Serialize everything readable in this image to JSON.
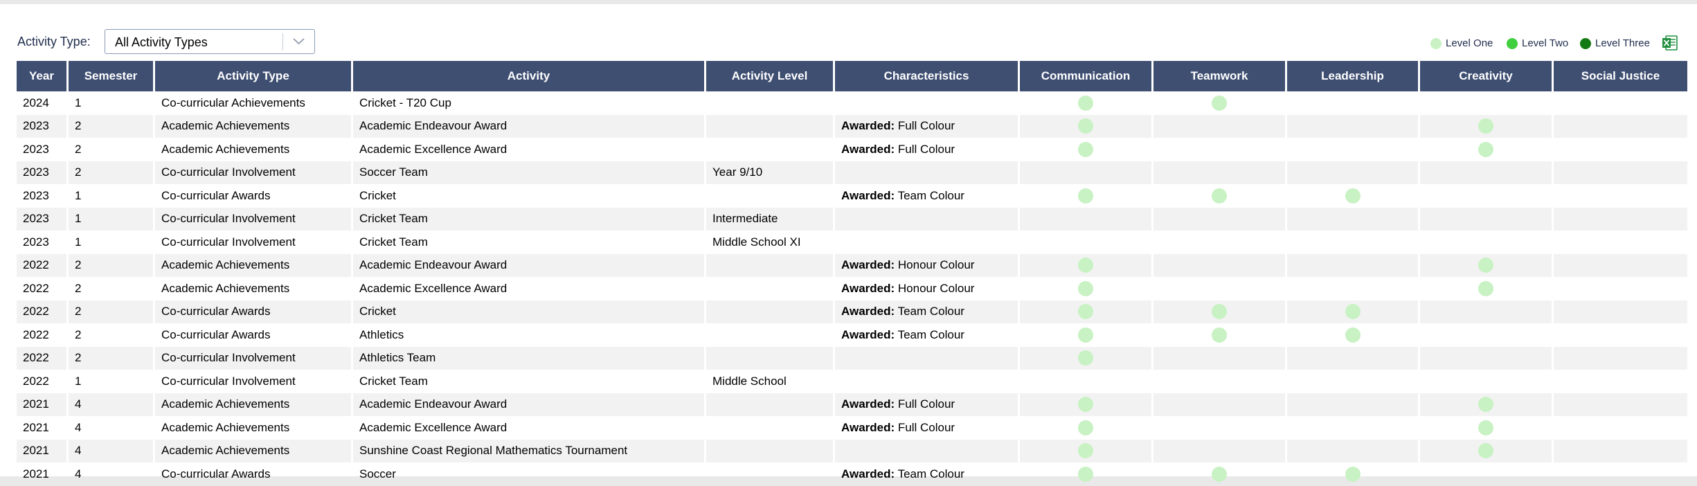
{
  "filter": {
    "label": "Activity Type:",
    "selected": "All Activity Types"
  },
  "legend": [
    {
      "label": "Level One",
      "color": "#c8f2c3"
    },
    {
      "label": "Level Two",
      "color": "#3fcf3f"
    },
    {
      "label": "Level Three",
      "color": "#137a13"
    }
  ],
  "export_icon": "excel-export-icon",
  "columns": [
    "Year",
    "Semester",
    "Activity Type",
    "Activity",
    "Activity Level",
    "Characteristics",
    "Communication",
    "Teamwork",
    "Leadership",
    "Creativity",
    "Social Justice"
  ],
  "awarded_label": "Awarded:",
  "rows": [
    {
      "year": "2024",
      "semester": "1",
      "type": "Co-curricular Achievements",
      "activity": "Cricket - T20 Cup",
      "level": "",
      "awarded": "",
      "skills": [
        1,
        1,
        0,
        0,
        0
      ]
    },
    {
      "year": "2023",
      "semester": "2",
      "type": "Academic Achievements",
      "activity": "Academic Endeavour Award",
      "level": "",
      "awarded": "Full Colour",
      "skills": [
        1,
        0,
        0,
        1,
        0
      ]
    },
    {
      "year": "2023",
      "semester": "2",
      "type": "Academic Achievements",
      "activity": "Academic Excellence Award",
      "level": "",
      "awarded": "Full Colour",
      "skills": [
        1,
        0,
        0,
        1,
        0
      ]
    },
    {
      "year": "2023",
      "semester": "2",
      "type": "Co-curricular Involvement",
      "activity": "Soccer Team",
      "level": "Year 9/10",
      "awarded": "",
      "skills": [
        0,
        0,
        0,
        0,
        0
      ]
    },
    {
      "year": "2023",
      "semester": "1",
      "type": "Co-curricular Awards",
      "activity": "Cricket",
      "level": "",
      "awarded": "Team Colour",
      "skills": [
        1,
        1,
        1,
        0,
        0
      ]
    },
    {
      "year": "2023",
      "semester": "1",
      "type": "Co-curricular Involvement",
      "activity": "Cricket Team",
      "level": "Intermediate",
      "awarded": "",
      "skills": [
        0,
        0,
        0,
        0,
        0
      ]
    },
    {
      "year": "2023",
      "semester": "1",
      "type": "Co-curricular Involvement",
      "activity": "Cricket Team",
      "level": "Middle School XI",
      "awarded": "",
      "skills": [
        0,
        0,
        0,
        0,
        0
      ]
    },
    {
      "year": "2022",
      "semester": "2",
      "type": "Academic Achievements",
      "activity": "Academic Endeavour Award",
      "level": "",
      "awarded": "Honour Colour",
      "skills": [
        1,
        0,
        0,
        1,
        0
      ]
    },
    {
      "year": "2022",
      "semester": "2",
      "type": "Academic Achievements",
      "activity": "Academic Excellence Award",
      "level": "",
      "awarded": "Honour Colour",
      "skills": [
        1,
        0,
        0,
        1,
        0
      ]
    },
    {
      "year": "2022",
      "semester": "2",
      "type": "Co-curricular Awards",
      "activity": "Cricket",
      "level": "",
      "awarded": "Team Colour",
      "skills": [
        1,
        1,
        1,
        0,
        0
      ]
    },
    {
      "year": "2022",
      "semester": "2",
      "type": "Co-curricular Awards",
      "activity": "Athletics",
      "level": "",
      "awarded": "Team Colour",
      "skills": [
        1,
        1,
        1,
        0,
        0
      ]
    },
    {
      "year": "2022",
      "semester": "2",
      "type": "Co-curricular Involvement",
      "activity": "Athletics Team",
      "level": "",
      "awarded": "",
      "skills": [
        1,
        0,
        0,
        0,
        0
      ]
    },
    {
      "year": "2022",
      "semester": "1",
      "type": "Co-curricular Involvement",
      "activity": "Cricket Team",
      "level": "Middle School",
      "awarded": "",
      "skills": [
        0,
        0,
        0,
        0,
        0
      ]
    },
    {
      "year": "2021",
      "semester": "4",
      "type": "Academic Achievements",
      "activity": "Academic Endeavour Award",
      "level": "",
      "awarded": "Full Colour",
      "skills": [
        1,
        0,
        0,
        1,
        0
      ]
    },
    {
      "year": "2021",
      "semester": "4",
      "type": "Academic Achievements",
      "activity": "Academic Excellence Award",
      "level": "",
      "awarded": "Full Colour",
      "skills": [
        1,
        0,
        0,
        1,
        0
      ]
    },
    {
      "year": "2021",
      "semester": "4",
      "type": "Academic Achievements",
      "activity": "Sunshine Coast Regional Mathematics Tournament",
      "level": "",
      "awarded": "",
      "skills": [
        1,
        0,
        0,
        1,
        0
      ]
    },
    {
      "year": "2021",
      "semester": "4",
      "type": "Co-curricular Awards",
      "activity": "Soccer",
      "level": "",
      "awarded": "Team Colour",
      "skills": [
        1,
        1,
        1,
        0,
        0
      ]
    }
  ]
}
